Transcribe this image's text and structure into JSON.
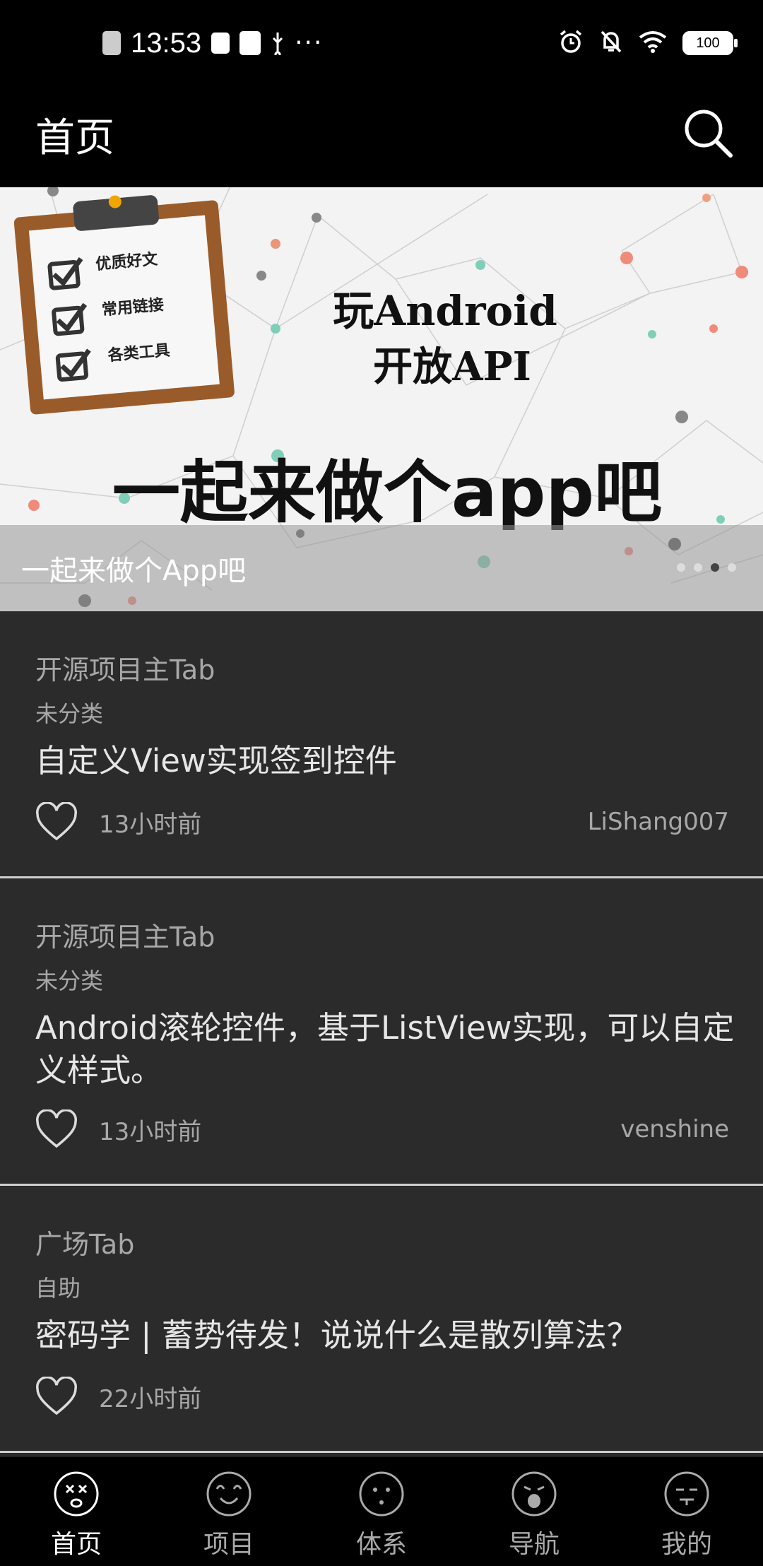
{
  "status_bar": {
    "time": "13:53",
    "battery": "100",
    "left_icons": [
      "sim-off-icon",
      "clipboard-check-icon",
      "app-icon",
      "usb-icon",
      "more-dots-icon"
    ],
    "right_icons": [
      "alarm-icon",
      "bell-off-icon",
      "wifi-icon",
      "battery-icon"
    ]
  },
  "toolbar": {
    "title": "首页",
    "search_icon": "search-icon"
  },
  "banner": {
    "clipboard_items": [
      "优质好文",
      "常用链接",
      "各类工具"
    ],
    "headline_line1": "玩Android",
    "headline_line2": "开放API",
    "slogan": "一起来做个app吧",
    "caption": "一起来做个App吧",
    "page_count": 4,
    "active_index": 2
  },
  "articles": [
    {
      "category": "开源项目主Tab",
      "tag": "未分类",
      "title": "自定义View实现签到控件",
      "time": "13小时前",
      "author": "LiShang007"
    },
    {
      "category": "开源项目主Tab",
      "tag": "未分类",
      "title": "Android滚轮控件，基于ListView实现，可以自定义样式。",
      "time": "13小时前",
      "author": "venshine"
    },
    {
      "category": "广场Tab",
      "tag": "自助",
      "title": "密码学 | 蓄势待发！说说什么是散列算法？",
      "time": "22小时前",
      "author": ""
    }
  ],
  "bottom_nav": [
    {
      "label": "首页",
      "icon": "home-face-icon",
      "active": true
    },
    {
      "label": "项目",
      "icon": "project-face-icon",
      "active": false
    },
    {
      "label": "体系",
      "icon": "system-face-icon",
      "active": false
    },
    {
      "label": "导航",
      "icon": "nav-face-icon",
      "active": false
    },
    {
      "label": "我的",
      "icon": "me-face-icon",
      "active": false
    }
  ],
  "colors": {
    "bar_bg": "#000000",
    "card_bg": "#2b2b2b",
    "divider": "#cfcfcf",
    "secondary_text": "#a8a8a8"
  }
}
